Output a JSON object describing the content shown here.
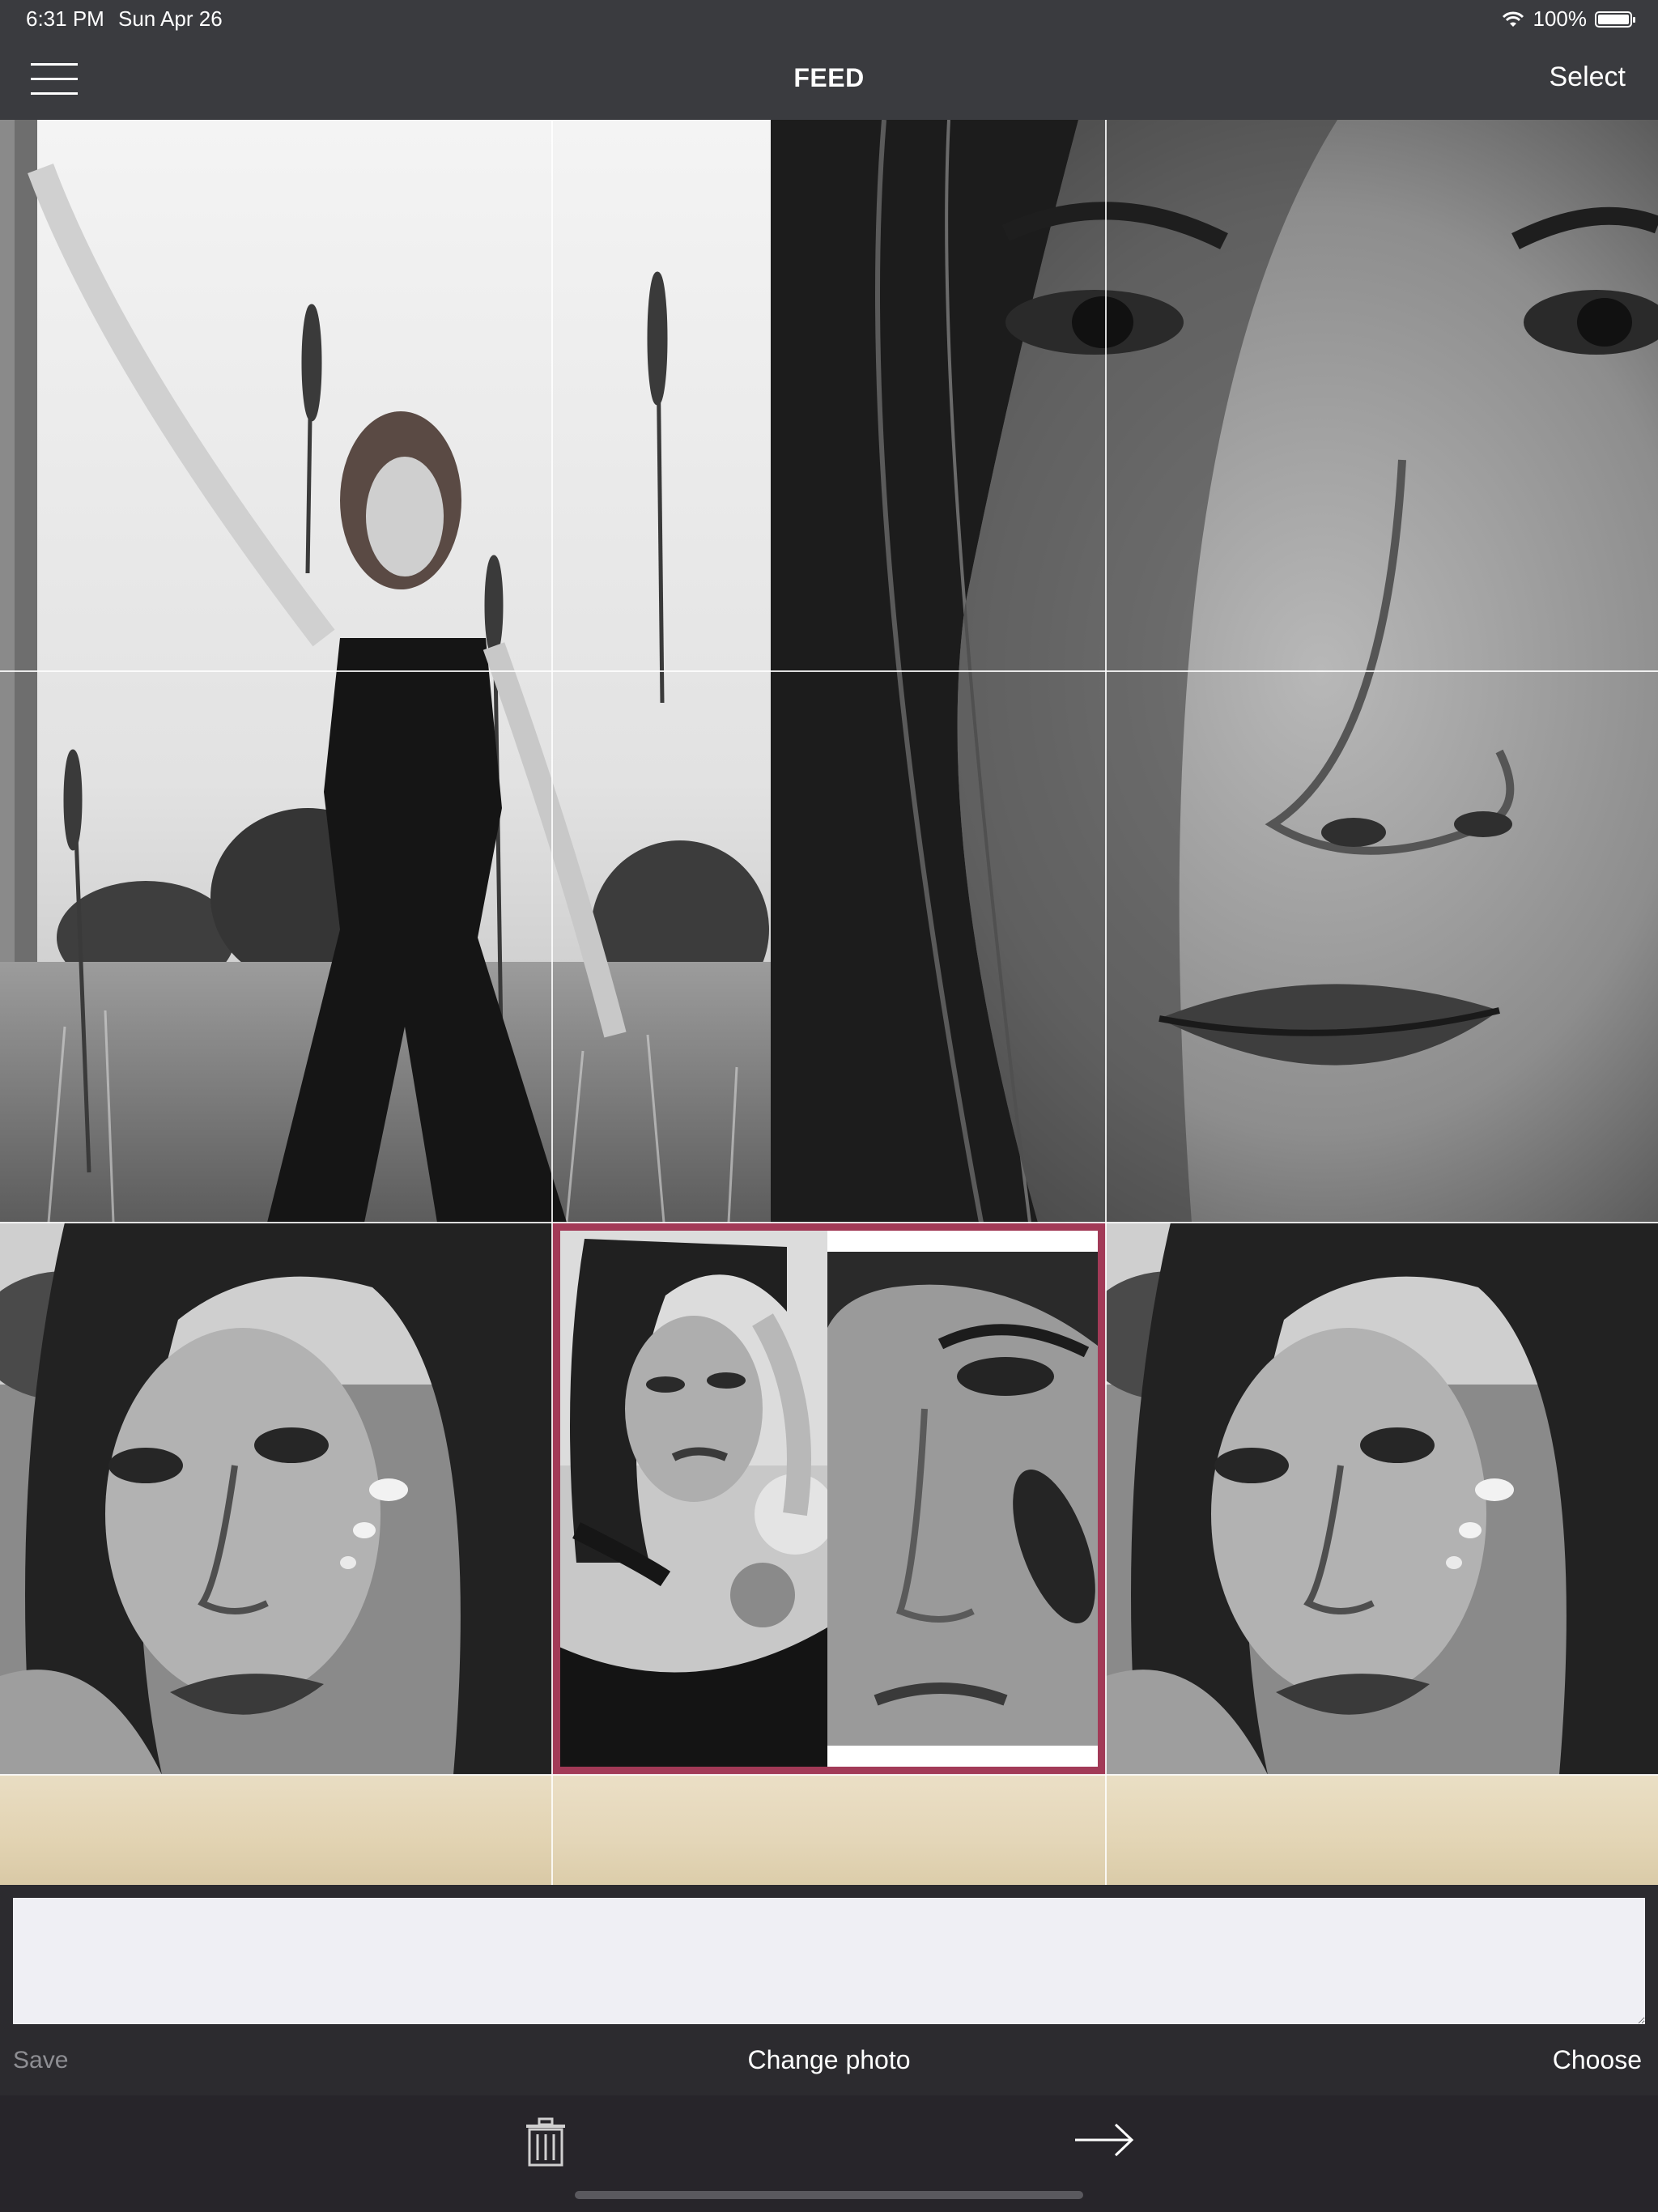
{
  "status_bar": {
    "time": "6:31 PM",
    "date": "Sun Apr 26",
    "battery_percent": "100%",
    "icons": [
      "wifi-icon",
      "battery-icon"
    ]
  },
  "nav": {
    "menu_icon": "hamburger-menu-icon",
    "title": "FEED",
    "select_label": "Select"
  },
  "grid": {
    "columns": 3,
    "selected_tile": "grid-tile-2-2",
    "selection_color": "#a23a57",
    "tiles": [
      {
        "name": "grid-tile-woman-standing-field",
        "description": "black and white photo"
      },
      {
        "name": "grid-tile-face-closeup",
        "description": "black and white photo"
      },
      {
        "name": "grid-tile-face-left",
        "description": "black and white photo"
      },
      {
        "name": "grid-tile-collage-selected",
        "description": "black and white collage"
      },
      {
        "name": "grid-tile-face-right",
        "description": "black and white photo"
      },
      {
        "name": "grid-tile-paper-1",
        "description": "beige paper texture"
      },
      {
        "name": "grid-tile-paper-2",
        "description": "beige paper texture"
      },
      {
        "name": "grid-tile-paper-3",
        "description": "beige paper texture"
      }
    ]
  },
  "caption": {
    "placeholder": ""
  },
  "actions": {
    "save_label": "Save",
    "change_photo_label": "Change photo",
    "choose_label": "Choose"
  },
  "toolbar": {
    "delete_icon": "trash-icon",
    "next_icon": "arrow-right-icon"
  },
  "colors": {
    "bar_background": "#3a3b3f",
    "bottom_background": "#2c2b2f",
    "caption_background": "#efeff4",
    "disabled_text": "#8e8e93",
    "paper": "#e8dcc0"
  }
}
